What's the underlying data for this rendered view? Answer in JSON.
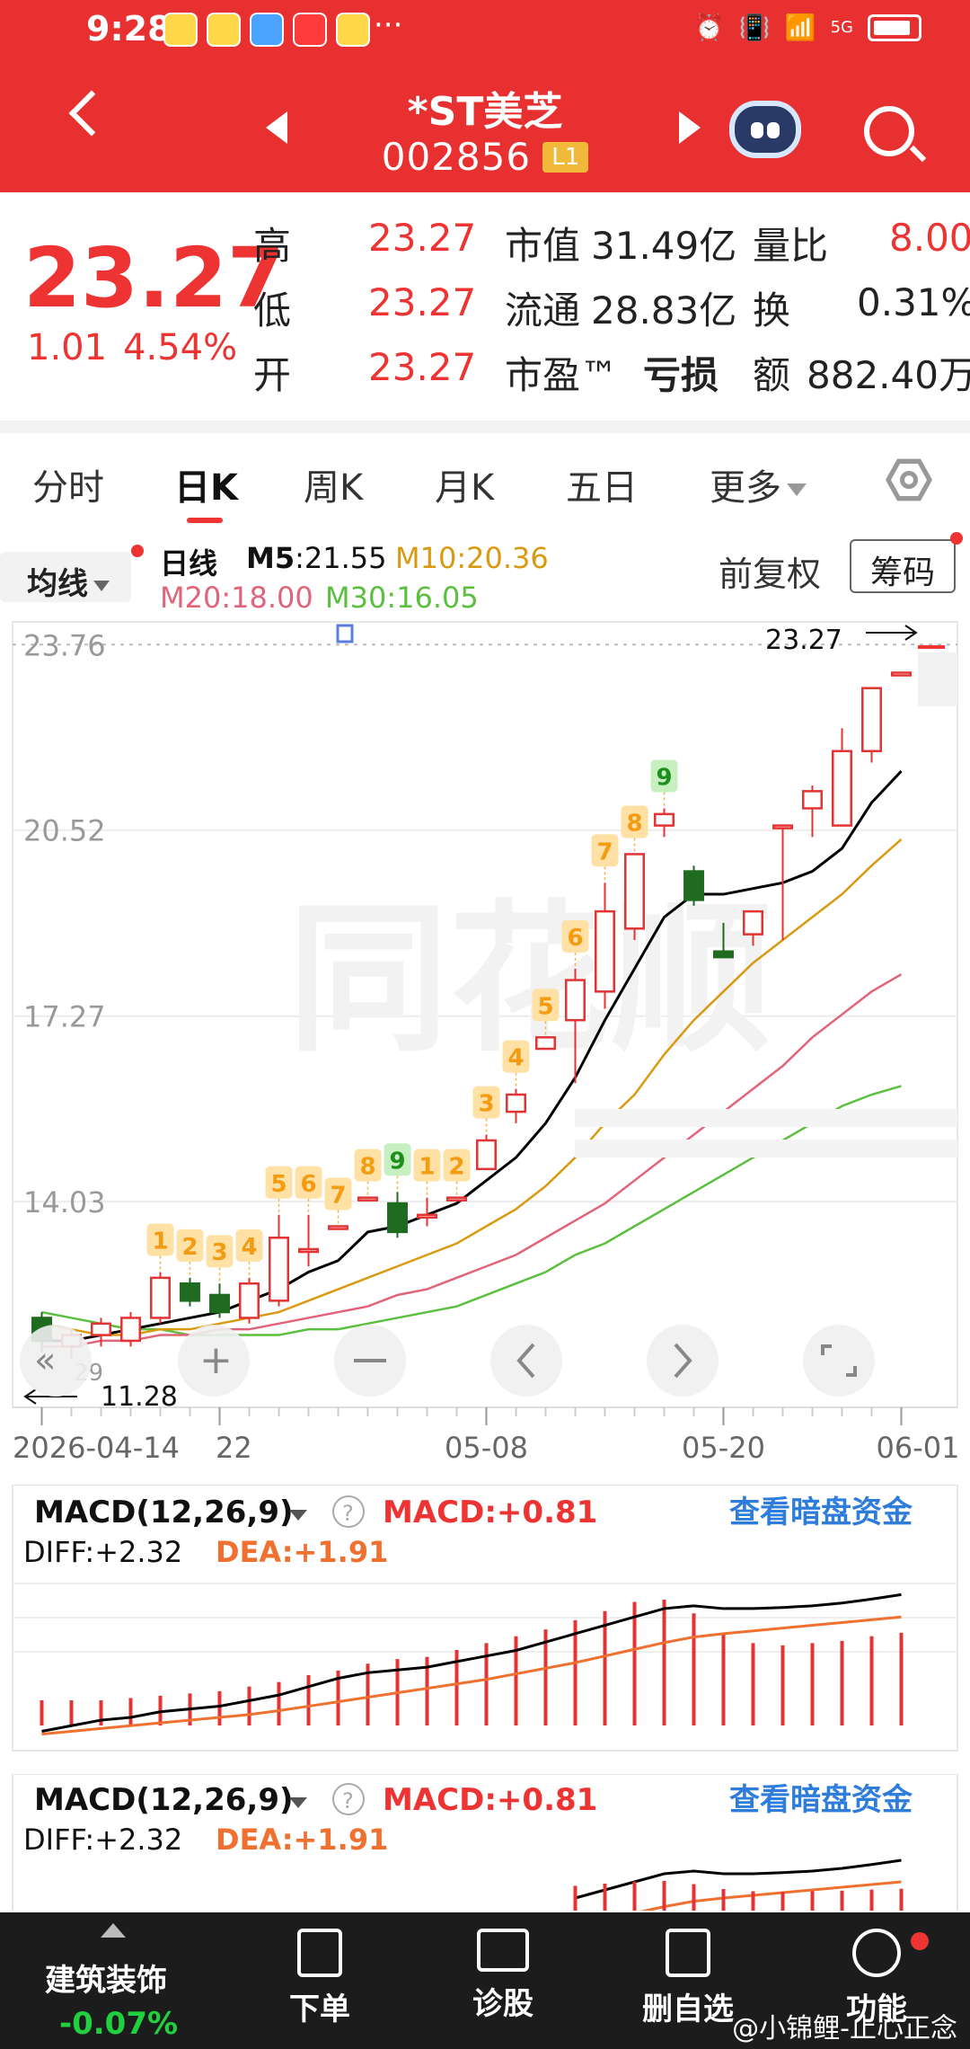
{
  "status": {
    "time": "9:28",
    "more": "···",
    "net": "5G"
  },
  "header": {
    "stock_name": "*ST美芝",
    "stock_code": "002856",
    "level": "L1"
  },
  "quote": {
    "price": "23.27",
    "change": "1.01",
    "change_pct": "4.54%",
    "high_label": "高",
    "high": "23.27",
    "low_label": "低",
    "low": "23.27",
    "open_label": "开",
    "open": "23.27",
    "mktcap_label": "市值",
    "mktcap": "31.49亿",
    "float_label": "流通",
    "float": "28.83亿",
    "pe_label": "市盈™",
    "pe": "亏损",
    "vol_ratio_label": "量比",
    "vol_ratio": "8.00",
    "turnover_label": "换",
    "turnover": "0.31%",
    "amount_label": "额",
    "amount": "882.40万"
  },
  "tabs": [
    "分时",
    "日K",
    "周K",
    "月K",
    "五日",
    "更多"
  ],
  "ma_bar": {
    "select_label": "均线",
    "line_label": "日线",
    "m5_name": "M5",
    "m5_value": ":21.55",
    "m10": "M10:20.36",
    "m20": "M20:18.00",
    "m30": "M30:16.05",
    "adjust": "前复权",
    "chips": "筹码"
  },
  "colors": {
    "up": "#e33333",
    "down": "#1f6b1f",
    "m5": "#000000",
    "m10": "#d99a12",
    "m20": "#e0647a",
    "m30": "#5bbf3f",
    "dif": "#000000",
    "dea": "#f07030"
  },
  "kchart": {
    "y_ticks": [
      "23.76",
      "20.52",
      "17.27",
      "14.03"
    ],
    "last_price_marker": "23.27",
    "low_marker": "11.28",
    "low_marker_side": "29",
    "x_labels": [
      "2026-04-14",
      "22",
      "05-08",
      "05-20",
      "06-01"
    ]
  },
  "chart_data": {
    "type": "candlestick",
    "ylim": [
      10.5,
      24.0
    ],
    "y_ticks": [
      23.76,
      20.52,
      17.27,
      14.03
    ],
    "x_ticks": [
      "2026-04-14",
      "22",
      "05-08",
      "05-20",
      "06-01"
    ],
    "candles": [
      {
        "o": 12.0,
        "c": 11.6,
        "h": 12.1,
        "l": 11.4
      },
      {
        "o": 11.5,
        "c": 11.7,
        "h": 11.8,
        "l": 11.3
      },
      {
        "o": 11.7,
        "c": 11.9,
        "h": 12.0,
        "l": 11.5
      },
      {
        "o": 11.6,
        "c": 12.0,
        "h": 12.1,
        "l": 11.5
      },
      {
        "o": 12.0,
        "c": 12.7,
        "h": 12.8,
        "l": 11.9
      },
      {
        "o": 12.6,
        "c": 12.3,
        "h": 12.7,
        "l": 12.2
      },
      {
        "o": 12.4,
        "c": 12.1,
        "h": 12.6,
        "l": 12.0
      },
      {
        "o": 12.0,
        "c": 12.6,
        "h": 12.7,
        "l": 11.9
      },
      {
        "o": 12.3,
        "c": 13.4,
        "h": 13.8,
        "l": 12.2
      },
      {
        "o": 13.2,
        "c": 13.2,
        "h": 13.8,
        "l": 12.9
      },
      {
        "o": 13.6,
        "c": 13.6,
        "h": 13.6,
        "l": 13.6
      },
      {
        "o": 14.1,
        "c": 14.1,
        "h": 14.1,
        "l": 14.1
      },
      {
        "o": 14.0,
        "c": 13.5,
        "h": 14.2,
        "l": 13.4
      },
      {
        "o": 13.8,
        "c": 13.8,
        "h": 14.1,
        "l": 13.6
      },
      {
        "o": 14.1,
        "c": 14.1,
        "h": 14.1,
        "l": 14.1
      },
      {
        "o": 14.6,
        "c": 15.1,
        "h": 15.2,
        "l": 14.6
      },
      {
        "o": 15.6,
        "c": 15.9,
        "h": 16.0,
        "l": 15.4
      },
      {
        "o": 16.7,
        "c": 16.9,
        "h": 16.9,
        "l": 16.7
      },
      {
        "o": 17.2,
        "c": 17.9,
        "h": 18.1,
        "l": 16.1
      },
      {
        "o": 17.7,
        "c": 19.1,
        "h": 19.6,
        "l": 17.4
      },
      {
        "o": 18.8,
        "c": 20.1,
        "h": 20.1,
        "l": 18.6
      },
      {
        "o": 20.6,
        "c": 20.8,
        "h": 20.9,
        "l": 20.4
      },
      {
        "o": 19.8,
        "c": 19.3,
        "h": 19.9,
        "l": 19.2
      },
      {
        "o": 18.4,
        "c": 18.3,
        "h": 18.9,
        "l": 18.3
      },
      {
        "o": 18.7,
        "c": 19.1,
        "h": 19.1,
        "l": 18.5
      },
      {
        "o": 20.6,
        "c": 20.6,
        "h": 20.6,
        "l": 18.6
      },
      {
        "o": 20.9,
        "c": 21.2,
        "h": 21.3,
        "l": 20.4
      },
      {
        "o": 20.6,
        "c": 21.9,
        "h": 22.3,
        "l": 20.6
      },
      {
        "o": 21.9,
        "c": 23.0,
        "h": 23.0,
        "l": 21.7
      },
      {
        "o": 23.27,
        "c": 23.27,
        "h": 23.27,
        "l": 23.27
      }
    ],
    "td_counts": [
      {
        "i": 4,
        "label": "1",
        "color": "orange"
      },
      {
        "i": 5,
        "label": "2",
        "color": "orange"
      },
      {
        "i": 6,
        "label": "3",
        "color": "orange"
      },
      {
        "i": 7,
        "label": "4",
        "color": "orange"
      },
      {
        "i": 8,
        "label": "5",
        "color": "orange"
      },
      {
        "i": 9,
        "label": "6",
        "color": "orange"
      },
      {
        "i": 10,
        "label": "7",
        "color": "orange"
      },
      {
        "i": 11,
        "label": "8",
        "color": "orange"
      },
      {
        "i": 12,
        "label": "9",
        "color": "green"
      },
      {
        "i": 13,
        "label": "1",
        "color": "orange"
      },
      {
        "i": 14,
        "label": "2",
        "color": "orange"
      },
      {
        "i": 15,
        "label": "3",
        "color": "orange"
      },
      {
        "i": 16,
        "label": "4",
        "color": "orange"
      },
      {
        "i": 17,
        "label": "5",
        "color": "orange"
      },
      {
        "i": 18,
        "label": "6",
        "color": "orange"
      },
      {
        "i": 19,
        "label": "7",
        "color": "orange"
      },
      {
        "i": 20,
        "label": "8",
        "color": "orange"
      },
      {
        "i": 21,
        "label": "9",
        "color": "green"
      }
    ],
    "ma5": [
      11.6,
      11.6,
      11.7,
      11.8,
      11.9,
      12.0,
      12.1,
      12.3,
      12.5,
      12.8,
      13.0,
      13.5,
      13.6,
      13.8,
      14.0,
      14.4,
      14.8,
      15.4,
      16.2,
      17.2,
      18.1,
      19.0,
      19.4,
      19.4,
      19.5,
      19.6,
      19.8,
      20.2,
      21.0,
      21.55
    ],
    "ma10": [
      11.9,
      11.8,
      11.7,
      11.7,
      11.8,
      11.8,
      11.9,
      12.0,
      12.1,
      12.3,
      12.5,
      12.7,
      12.9,
      13.1,
      13.3,
      13.6,
      13.9,
      14.3,
      14.8,
      15.4,
      15.9,
      16.6,
      17.2,
      17.7,
      18.2,
      18.6,
      19.0,
      19.4,
      19.9,
      20.36
    ],
    "ma20": [
      11.5,
      11.5,
      11.6,
      11.6,
      11.7,
      11.7,
      11.8,
      11.8,
      11.9,
      12.0,
      12.1,
      12.2,
      12.4,
      12.5,
      12.7,
      12.9,
      13.1,
      13.4,
      13.7,
      14.0,
      14.4,
      14.8,
      15.2,
      15.6,
      16.0,
      16.4,
      16.9,
      17.3,
      17.7,
      18.0
    ],
    "ma30": [
      12.1,
      12.0,
      11.9,
      11.8,
      11.8,
      11.7,
      11.7,
      11.7,
      11.7,
      11.8,
      11.8,
      11.9,
      12.0,
      12.1,
      12.2,
      12.4,
      12.6,
      12.8,
      13.1,
      13.3,
      13.6,
      13.9,
      14.2,
      14.5,
      14.8,
      15.1,
      15.4,
      15.7,
      15.9,
      16.05
    ],
    "macd_panel": {
      "title": "MACD(12,26,9)",
      "macd": "MACD:+0.81",
      "diff": "DIFF:+2.32",
      "dea": "DEA:+1.91",
      "link": "查看暗盘资金",
      "hist": [
        0.22,
        0.22,
        0.22,
        0.24,
        0.26,
        0.28,
        0.3,
        0.34,
        0.38,
        0.44,
        0.48,
        0.54,
        0.58,
        0.6,
        0.66,
        0.72,
        0.78,
        0.84,
        0.92,
        1.0,
        1.08,
        1.1,
        0.98,
        0.8,
        0.72,
        0.7,
        0.72,
        0.74,
        0.78,
        0.81
      ],
      "diff_series": [
        0.05,
        0.15,
        0.25,
        0.3,
        0.4,
        0.45,
        0.5,
        0.6,
        0.7,
        0.85,
        1.0,
        1.1,
        1.15,
        1.2,
        1.3,
        1.4,
        1.5,
        1.65,
        1.8,
        1.95,
        2.1,
        2.25,
        2.3,
        2.25,
        2.25,
        2.27,
        2.3,
        2.35,
        2.42,
        2.5
      ],
      "dea_series": [
        0.0,
        0.05,
        0.1,
        0.15,
        0.2,
        0.25,
        0.3,
        0.35,
        0.42,
        0.5,
        0.58,
        0.66,
        0.74,
        0.82,
        0.9,
        0.98,
        1.08,
        1.18,
        1.28,
        1.4,
        1.52,
        1.64,
        1.74,
        1.8,
        1.85,
        1.9,
        1.95,
        2.0,
        2.05,
        2.1
      ]
    }
  },
  "macd_panel2": {
    "title": "MACD(12,26,9)",
    "macd": "MACD:+0.81",
    "diff": "DIFF:+2.32",
    "dea": "DEA:+1.91",
    "link": "查看暗盘资金"
  },
  "bottom_nav": {
    "sector_name": "建筑装饰",
    "sector_pct": "-0.07%",
    "items": [
      "下单",
      "诊股",
      "删自选",
      "功能"
    ],
    "watermark": "@小锦鲤-止心正念"
  }
}
